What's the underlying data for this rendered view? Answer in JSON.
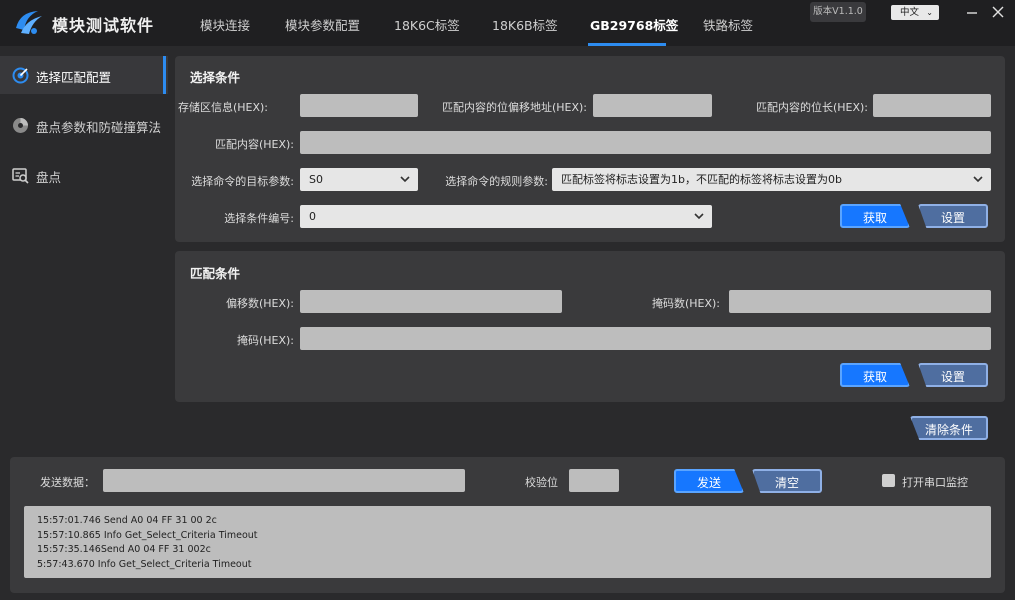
{
  "app": {
    "title": "模块测试软件",
    "version": "版本V1.1.0",
    "language": "中文"
  },
  "nav": {
    "tabs": [
      "模块连接",
      "模块参数配置",
      "18K6C标签",
      "18K6B标签",
      "GB29768标签",
      "铁路标签"
    ],
    "active_index": 4
  },
  "sidebar": {
    "items": [
      {
        "label": "选择匹配配置",
        "icon": "target-icon",
        "active": true
      },
      {
        "label": "盘点参数和防碰撞算法",
        "icon": "disc-icon",
        "active": false
      },
      {
        "label": "盘点",
        "icon": "inventory-search-icon",
        "active": false
      }
    ]
  },
  "select_panel": {
    "title": "选择条件",
    "storage_label": "存储区信息(HEX):",
    "storage_value": "",
    "offset_label": "匹配内容的位偏移地址(HEX):",
    "offset_value": "",
    "length_label": "匹配内容的位长(HEX):",
    "length_value": "",
    "content_label": "匹配内容(HEX):",
    "content_value": "",
    "target_label": "选择命令的目标参数:",
    "target_value": "S0",
    "rule_label": "选择命令的规则参数:",
    "rule_value": "匹配标签将标志设置为1b，不匹配的标签将标志设置为0b",
    "number_label": "选择条件编号:",
    "number_value": "0",
    "get_button": "获取",
    "set_button": "设置"
  },
  "match_panel": {
    "title": "匹配条件",
    "offset_label": "偏移数(HEX):",
    "offset_value": "",
    "mask_count_label": "掩码数(HEX):",
    "mask_count_value": "",
    "mask_label": "掩码(HEX):",
    "mask_value": "",
    "get_button": "获取",
    "set_button": "设置"
  },
  "clear_conditions_button": "清除条件",
  "send_area": {
    "send_label": "发送数据：",
    "send_value": "",
    "checksum_label": "校验位",
    "checksum_value": "",
    "send_button": "发送",
    "clear_button": "清空",
    "monitor_label": "打开串口监控",
    "monitor_checked": false
  },
  "log": {
    "lines": [
      "15:57:01.746 Send A0 04 FF 31 00 2c",
      "15:57:10.865 Info Get_Select_Criteria Timeout",
      "15:57:35.146Send A0 04 FF 31 002c",
      "5:57:43.670 Info Get_Select_Criteria Timeout"
    ]
  },
  "colors": {
    "accent": "#2d8cf0",
    "primary_button": "#1677ff",
    "secondary_button": "#4f6ea0",
    "panel": "#3a3a3c",
    "background": "#2a2a2c"
  }
}
